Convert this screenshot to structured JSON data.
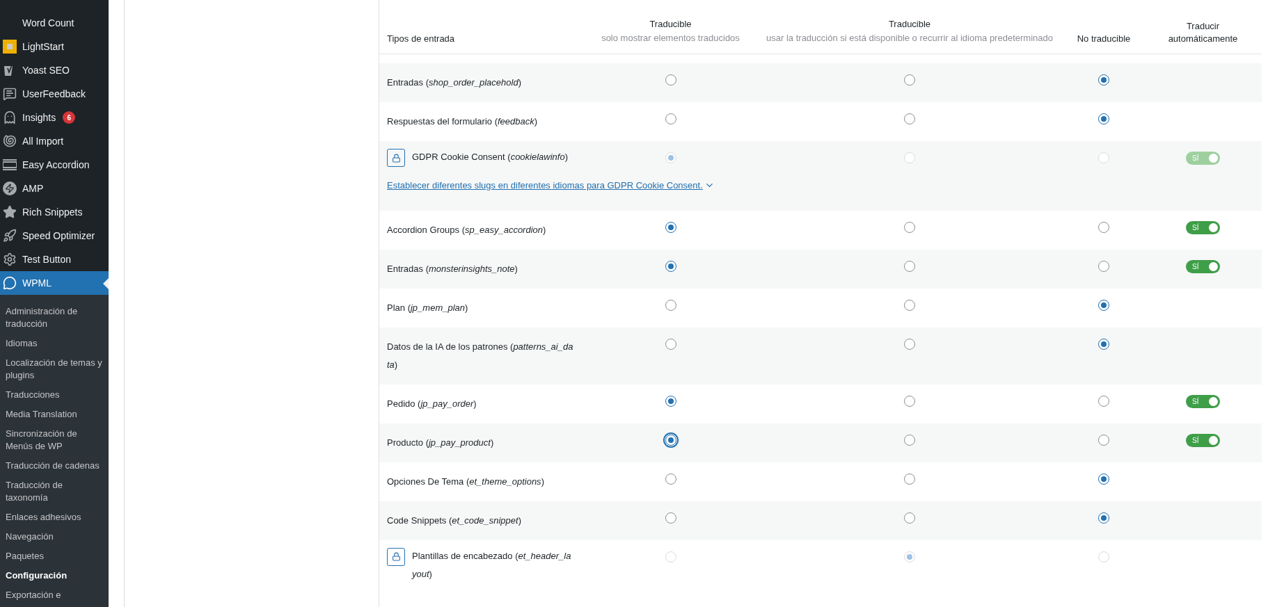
{
  "sidebar": {
    "items": [
      {
        "label": "Word Count",
        "selected": false
      },
      {
        "label": "LightStart",
        "selected": false
      },
      {
        "label": "Yoast SEO",
        "selected": false
      },
      {
        "label": "UserFeedback",
        "selected": false
      },
      {
        "label": "Insights",
        "badge": "6",
        "selected": false
      },
      {
        "label": "All Import",
        "selected": false
      },
      {
        "label": "Easy Accordion",
        "selected": false
      },
      {
        "label": "AMP",
        "selected": false
      },
      {
        "label": "Rich Snippets",
        "selected": false
      },
      {
        "label": "Speed Optimizer",
        "selected": false
      },
      {
        "label": "Test Button",
        "selected": false
      },
      {
        "label": "WPML",
        "selected": true
      }
    ],
    "submenu": [
      {
        "label": "Administración de traducción",
        "selected": false
      },
      {
        "label": "Idiomas",
        "selected": false
      },
      {
        "label": "Localización de temas y plugins",
        "selected": false
      },
      {
        "label": "Traducciones",
        "selected": false
      },
      {
        "label": "Media Translation",
        "selected": false
      },
      {
        "label": "Sincronización de Menús de WP",
        "selected": false
      },
      {
        "label": "Traducción de cadenas",
        "selected": false
      },
      {
        "label": "Traducción de taxonomía",
        "selected": false
      },
      {
        "label": "Enlaces adhesivos",
        "selected": false
      },
      {
        "label": "Navegación",
        "selected": false
      },
      {
        "label": "Paquetes",
        "selected": false
      },
      {
        "label": "Configuración",
        "selected": true
      },
      {
        "label": "Exportación e",
        "selected": false
      }
    ]
  },
  "table": {
    "columns": [
      {
        "title": "Tipos de entrada"
      },
      {
        "title": "Traducible",
        "subtitle": "solo mostrar elementos traducidos"
      },
      {
        "title": "Traducible",
        "subtitle": "usar la traducción si está disponible o recurrir al idioma predeterminado"
      },
      {
        "title": "No traducible"
      },
      {
        "title": "Traducir automáticamente"
      }
    ],
    "rows": [
      {
        "name": "Entradas (*shop_order_placehold*)",
        "locked": false,
        "radios": [
          {
            "selected": false
          },
          {
            "selected": false
          },
          {
            "selected": true
          }
        ]
      },
      {
        "name": "Respuestas del formulario (*feedback*)",
        "locked": false,
        "radios": [
          {
            "selected": false
          },
          {
            "selected": false
          },
          {
            "selected": true
          }
        ]
      },
      {
        "name": "GDPR Cookie Consent (*cookielawinfo*)",
        "locked": true,
        "radios": [
          {
            "selected": true
          },
          {
            "selected": false
          },
          {
            "selected": false
          }
        ],
        "toggle": {
          "label": "SÍ",
          "on": true,
          "disabled": true
        },
        "link": "Establecer diferentes slugs en diferentes idiomas para GDPR Cookie Consent."
      },
      {
        "name": "Accordion Groups (*sp_easy_accordion*)",
        "locked": false,
        "radios": [
          {
            "selected": true
          },
          {
            "selected": false
          },
          {
            "selected": false
          }
        ],
        "toggle": {
          "label": "SÍ",
          "on": true,
          "disabled": false
        }
      },
      {
        "name": "Entradas (*monsterinsights_note*)",
        "locked": false,
        "radios": [
          {
            "selected": true
          },
          {
            "selected": false
          },
          {
            "selected": false
          }
        ],
        "toggle": {
          "label": "SÍ",
          "on": true,
          "disabled": false
        }
      },
      {
        "name": "Plan (*jp_mem_plan*)",
        "locked": false,
        "radios": [
          {
            "selected": false
          },
          {
            "selected": false
          },
          {
            "selected": true
          }
        ]
      },
      {
        "name": "Datos de la IA de los patrones (*patterns_ai_data*)",
        "locked": false,
        "radios": [
          {
            "selected": false
          },
          {
            "selected": false
          },
          {
            "selected": true
          }
        ]
      },
      {
        "name": "Pedido (*jp_pay_order*)",
        "locked": false,
        "radios": [
          {
            "selected": true
          },
          {
            "selected": false
          },
          {
            "selected": false
          }
        ],
        "toggle": {
          "label": "SÍ",
          "on": true,
          "disabled": false
        }
      },
      {
        "name": "Producto (*jp_pay_product*)",
        "locked": false,
        "focused": true,
        "radios": [
          {
            "selected": true
          },
          {
            "selected": false
          },
          {
            "selected": false
          }
        ],
        "toggle": {
          "label": "SÍ",
          "on": true,
          "disabled": false
        }
      },
      {
        "name": "Opciones De Tema (*et_theme_options*)",
        "locked": false,
        "radios": [
          {
            "selected": false
          },
          {
            "selected": false
          },
          {
            "selected": true
          }
        ]
      },
      {
        "name": "Code Snippets (*et_code_snippet*)",
        "locked": false,
        "radios": [
          {
            "selected": false
          },
          {
            "selected": false
          },
          {
            "selected": true
          }
        ]
      },
      {
        "name": "Plantillas de encabezado (*et_header_layout*)",
        "locked": true,
        "radios": [
          {
            "selected": false
          },
          {
            "selected": true
          },
          {
            "selected": false
          }
        ]
      }
    ]
  }
}
